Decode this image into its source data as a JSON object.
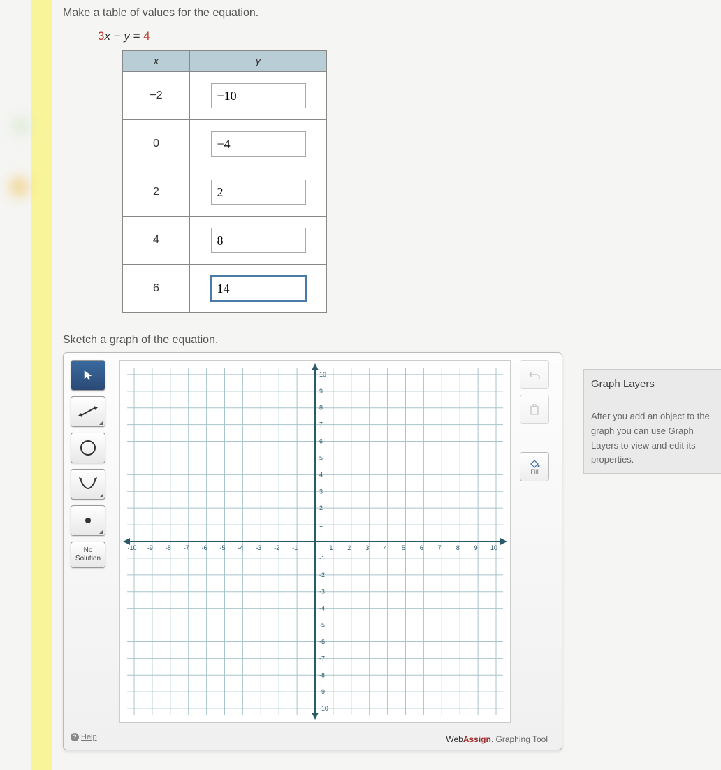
{
  "question": {
    "prompt1": "Make a table of values for the equation.",
    "equation_lhs_coef": "3",
    "equation_var1": "x",
    "equation_op": " − ",
    "equation_var2": "y",
    "equation_eq": " = ",
    "equation_rhs": "4",
    "prompt2": "Sketch a graph of the equation."
  },
  "table": {
    "header_x": "x",
    "header_y": "y",
    "rows": [
      {
        "x": "−2",
        "y": "−10"
      },
      {
        "x": "0",
        "y": "−4"
      },
      {
        "x": "2",
        "y": "2"
      },
      {
        "x": "4",
        "y": "8"
      },
      {
        "x": "6",
        "y": "14"
      }
    ]
  },
  "grapher": {
    "tools": {
      "no_solution_line1": "No",
      "no_solution_line2": "Solution",
      "fill_label": "Fill",
      "help_label": "Help"
    },
    "axis": {
      "min": -10,
      "max": 10,
      "ticks": [
        "-10",
        "-9",
        "-8",
        "-7",
        "-6",
        "-5",
        "-4",
        "-3",
        "-2",
        "-1",
        "1",
        "2",
        "3",
        "4",
        "5",
        "6",
        "7",
        "8",
        "9",
        "10"
      ]
    },
    "footer": {
      "brand_prefix": "Web",
      "brand_bold": "Assign",
      "brand_suffix": ". Graphing Tool"
    }
  },
  "layers": {
    "title": "Graph Layers",
    "description": "After you add an object to the graph you can use Graph Layers to view and edit its properties."
  },
  "chart_data": {
    "type": "line",
    "title": "",
    "xlabel": "",
    "ylabel": "",
    "xlim": [
      -10,
      10
    ],
    "ylim": [
      -10,
      10
    ],
    "series": []
  }
}
